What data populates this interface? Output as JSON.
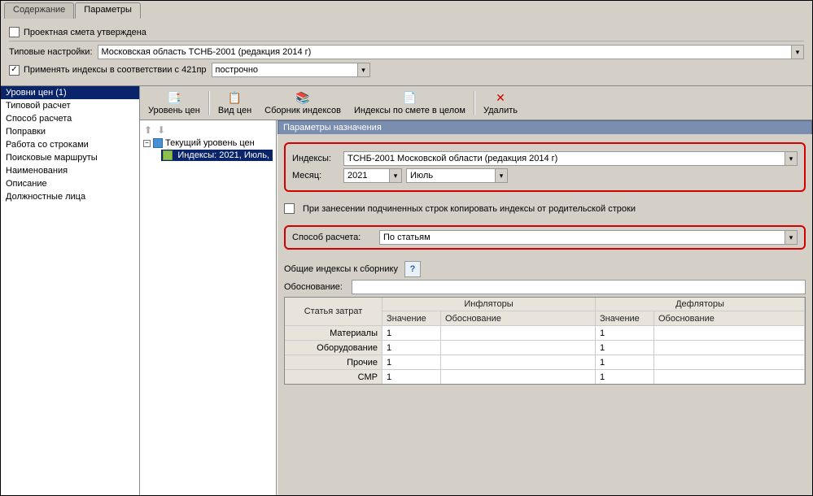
{
  "tabs": {
    "content": "Содержание",
    "parameters": "Параметры"
  },
  "top": {
    "approved_label": "Проектная смета утверждена",
    "typical_settings_label": "Типовые настройки:",
    "typical_settings_value": "Московская область ТСНБ-2001 (редакция 2014 г)",
    "apply_indexes_label": "Применять индексы в соответствии с 421пр",
    "apply_indexes_mode": "построчно"
  },
  "sidebar": {
    "items": [
      "Уровни цен (1)",
      "Типовой расчет",
      "Способ расчета",
      "Поправки",
      "Работа со строками",
      "Поисковые маршруты",
      "Наименования",
      "Описание",
      "Должностные лица"
    ]
  },
  "toolbar": {
    "level": "Уровень цен",
    "view": "Вид цен",
    "collection": "Сборник индексов",
    "estimate": "Индексы по смете в целом",
    "delete": "Удалить"
  },
  "tree": {
    "root_label": "Текущий уровень цен",
    "child_label": "Индексы: 2021, Июль,"
  },
  "detail": {
    "header": "Параметры назначения",
    "indexes_label": "Индексы:",
    "indexes_value": "ТСНБ-2001 Московской области (редакция 2014 г)",
    "month_label": "Месяц:",
    "year_value": "2021",
    "month_value": "Июль",
    "copy_children_label": "При занесении подчиненных строк копировать индексы от родительской строки",
    "calc_method_label": "Способ расчета:",
    "calc_method_value": "По статьям",
    "common_indexes_label": "Общие индексы к сборнику",
    "basis_label": "Обоснование:"
  },
  "grid": {
    "col_expense": "Статья затрат",
    "col_inflators": "Инфляторы",
    "col_deflators": "Дефляторы",
    "col_value": "Значение",
    "col_basis": "Обоснование",
    "rows": [
      {
        "name": "Материалы",
        "inf_v": "1",
        "inf_b": "",
        "def_v": "1",
        "def_b": ""
      },
      {
        "name": "Оборудование",
        "inf_v": "1",
        "inf_b": "",
        "def_v": "1",
        "def_b": ""
      },
      {
        "name": "Прочие",
        "inf_v": "1",
        "inf_b": "",
        "def_v": "1",
        "def_b": ""
      },
      {
        "name": "СМР",
        "inf_v": "1",
        "inf_b": "",
        "def_v": "1",
        "def_b": ""
      }
    ]
  }
}
